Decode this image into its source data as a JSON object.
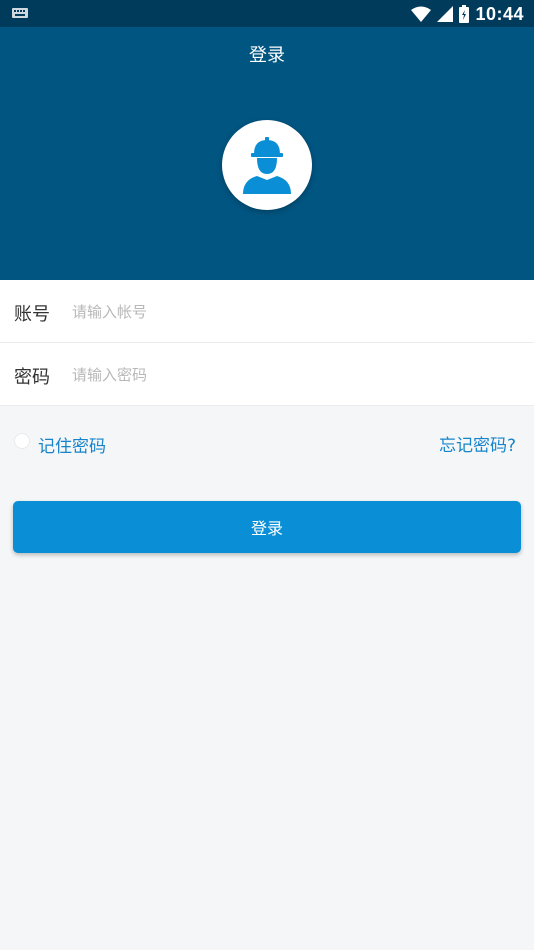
{
  "status_bar": {
    "time": "10:44",
    "icons": [
      "keyboard-icon",
      "wifi-icon",
      "signal-icon",
      "battery-icon"
    ]
  },
  "header": {
    "title": "登录",
    "avatar_icon": "worker-helmet-icon"
  },
  "form": {
    "account_label": "账号",
    "account_placeholder": "请输入帐号",
    "account_value": "",
    "password_label": "密码",
    "password_placeholder": "请输入密码",
    "password_value": ""
  },
  "options": {
    "remember_label": "记住密码",
    "remember_checked": false,
    "forgot_label": "忘记密码?"
  },
  "login_button": "登录",
  "colors": {
    "status_bar": "#003b5c",
    "header": "#005581",
    "accent": "#0a8fd6",
    "link": "#1784c9",
    "background": "#f4f6f8"
  }
}
